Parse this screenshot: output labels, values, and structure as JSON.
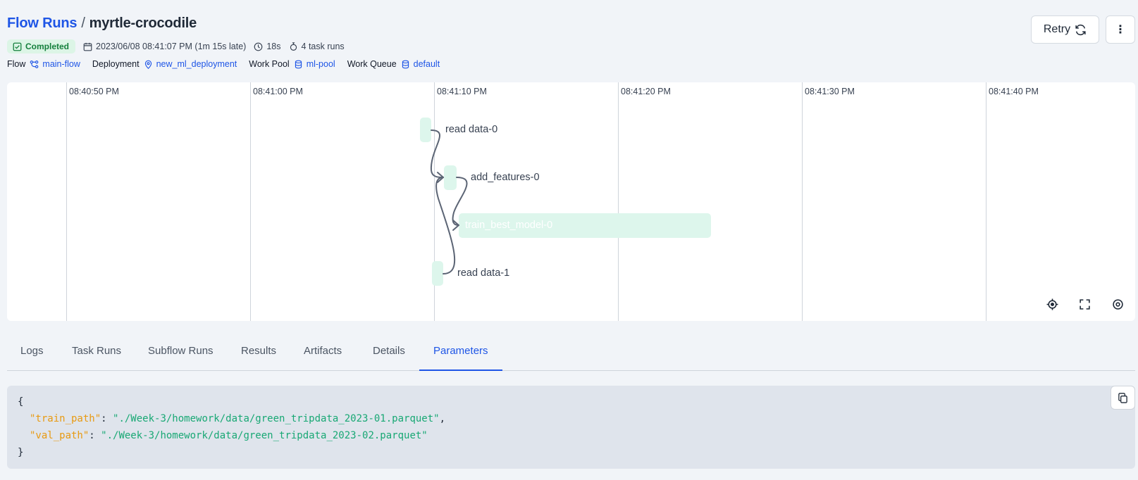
{
  "header": {
    "breadcrumb_root": "Flow Runs",
    "separator": "/",
    "run_name": "myrtle-crocodile",
    "state": "Completed",
    "start_time": "2023/06/08 08:41:07 PM (1m 15s late)",
    "duration": "18s",
    "task_runs": "4 task runs",
    "flow_label": "Flow",
    "flow_value": "main-flow",
    "deployment_label": "Deployment",
    "deployment_value": "new_ml_deployment",
    "work_pool_label": "Work Pool",
    "work_pool_value": "ml-pool",
    "work_queue_label": "Work Queue",
    "work_queue_value": "default",
    "retry_label": "Retry",
    "more_label": "⋮"
  },
  "timeline": {
    "ticks": [
      "08:40:50 PM",
      "08:41:00 PM",
      "08:41:10 PM",
      "08:41:20 PM",
      "08:41:30 PM",
      "08:41:40 PM"
    ],
    "nodes": [
      "read data-0",
      "add_features-0",
      "train_best_model-0",
      "read data-1"
    ],
    "controls": [
      "recenter-icon",
      "fullscreen-icon",
      "settings-icon"
    ]
  },
  "tabs": [
    "Logs",
    "Task Runs",
    "Subflow Runs",
    "Results",
    "Artifacts",
    "Details",
    "Parameters"
  ],
  "active_tab": "Parameters",
  "parameters": {
    "open_brace": "{",
    "close_brace": "}",
    "items": [
      {
        "key": "\"train_path\"",
        "value": "\"./Week-3/homework/data/green_tripdata_2023-01.parquet\"",
        "trail": ","
      },
      {
        "key": "\"val_path\"",
        "value": "\"./Week-3/homework/data/green_tripdata_2023-02.parquet\"",
        "trail": ""
      }
    ]
  },
  "colors": {
    "accent": "#1e55e6",
    "success_bg": "#dcf5e6",
    "success_text": "#15803d",
    "node_fill": "#ddf6ec",
    "json_key": "#e89a12",
    "json_string": "#18a874"
  }
}
